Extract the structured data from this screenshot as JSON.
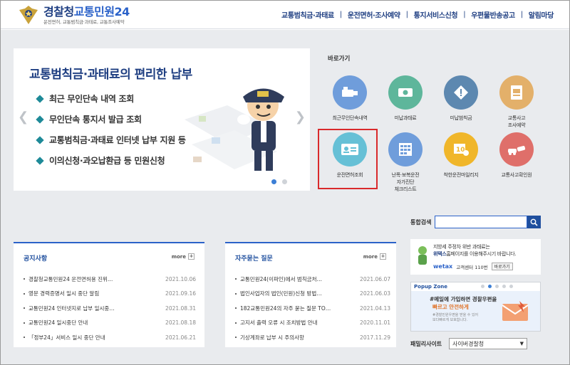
{
  "header": {
    "logo_title_a": "경찰청",
    "logo_title_b": "교통민원24",
    "logo_sub": "운전면허, 교통범칙금·과태료, 교통조사예약",
    "nav": [
      "교통범칙금·과태료",
      "운전면허·조사예약",
      "통지서비스신청",
      "우편물반송공고",
      "알림마당"
    ]
  },
  "banner": {
    "title": "교통범칙금·과태료의 편리한 납부",
    "items": [
      "최근 무인단속 내역 조회",
      "무인단속 통지서 발급 조회",
      "교통범칙금·과태료 인터넷 납부 지원 등",
      "이의신청·과오납환급 등 민원신청"
    ],
    "prev": "❮",
    "next": "❯"
  },
  "quick": {
    "title": "바로가기",
    "items": [
      {
        "label": "최근무인단속내역",
        "icon": "camera-icon",
        "color": "#6f9ddb"
      },
      {
        "label": "미납과태료",
        "icon": "money-icon",
        "color": "#5eb69b"
      },
      {
        "label": "미납범칙금",
        "icon": "warning-icon",
        "color": "#5d88b0"
      },
      {
        "label": "교통사고\n조사예약",
        "icon": "document-icon",
        "color": "#e3b06a"
      },
      {
        "label": "운전면허조회",
        "icon": "license-card-icon",
        "color": "#66c0d6"
      },
      {
        "label": "난폭·보복운전\n자가진단\n체크리스트",
        "icon": "calendar-check-icon",
        "color": "#6f9ddb"
      },
      {
        "label": "착한운전마일리지",
        "icon": "mileage-icon",
        "color": "#f0b62a"
      },
      {
        "label": "교통사고확인원",
        "icon": "car-crash-icon",
        "color": "#df6f6a"
      }
    ]
  },
  "search": {
    "label": "통합검색",
    "placeholder": ""
  },
  "notices": {
    "title": "공지사항",
    "more": "more",
    "items": [
      {
        "text": "경찰청교통민원24 운전면허용 진위…",
        "date": "2021.10.06"
      },
      {
        "text": "영문 경력증명서 일시 중단 알림",
        "date": "2021.09.16"
      },
      {
        "text": "교통민원24 인터넷지로 납부 일시중…",
        "date": "2021.08.31"
      },
      {
        "text": "교통민원24 일시중단 안내",
        "date": "2021.08.18"
      },
      {
        "text": "「정부24」서비스 일시 중단 안내",
        "date": "2021.06.21"
      }
    ]
  },
  "faq": {
    "title": "자주묻는 질문",
    "more": "more",
    "items": [
      {
        "text": "교통민원24(이파인)에서 범칙금처…",
        "date": "2021.06.07"
      },
      {
        "text": "법인사업자의 법인(민원)신청 방법…",
        "date": "2021.06.03"
      },
      {
        "text": "182교통민원24의 자주 묻는 질문 TO…",
        "date": "2021.04.13"
      },
      {
        "text": "고지서 출력 오류 시 조치방법 안내",
        "date": "2020.11.01"
      },
      {
        "text": "기상계좌로 납부 시 주의사항",
        "date": "2017.11.29"
      }
    ]
  },
  "ad": {
    "line1_a": "지방세 주정차 위반 과태료는",
    "line2_a": "위택스",
    "line2_b": "홈페이지를 이용해주시기 바랍니다.",
    "brand": "wetax",
    "center": "고객센터 110번",
    "go": "바로가기"
  },
  "popup": {
    "head": "Popup Zone",
    "l1": "#메일에 가입하면 경찰우편을",
    "l2": "빠르고 안전하게",
    "l3": "#경찰민원우편을 받을 수 있어\n보다빠르게 보호합니다."
  },
  "family": {
    "label": "패밀리사이트",
    "selected": "사이버경찰청"
  }
}
